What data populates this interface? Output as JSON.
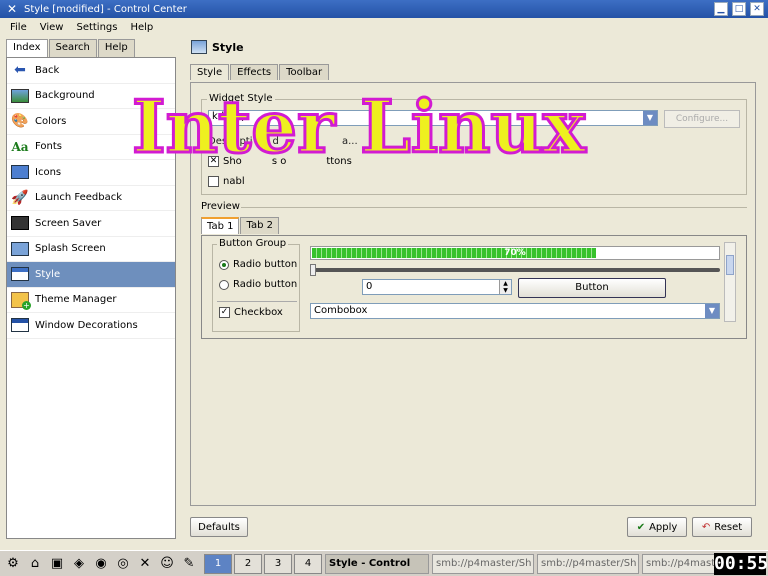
{
  "window": {
    "title": "Style [modified] - Control Center",
    "controls": {
      "minimize": "▁",
      "maximize": "□",
      "close": "✕"
    }
  },
  "menu": [
    "File",
    "View",
    "Settings",
    "Help"
  ],
  "left_tabs": [
    "Index",
    "Search",
    "Help"
  ],
  "left_items": [
    {
      "label": "Back",
      "icon": "back-arrow-icon"
    },
    {
      "label": "Background",
      "icon": "background-icon"
    },
    {
      "label": "Colors",
      "icon": "colors-icon"
    },
    {
      "label": "Fonts",
      "icon": "fonts-icon"
    },
    {
      "label": "Icons",
      "icon": "icons-icon"
    },
    {
      "label": "Launch Feedback",
      "icon": "rocket-icon"
    },
    {
      "label": "Screen Saver",
      "icon": "screen-saver-icon"
    },
    {
      "label": "Splash Screen",
      "icon": "splash-screen-icon"
    },
    {
      "label": "Style",
      "icon": "style-icon"
    },
    {
      "label": "Theme Manager",
      "icon": "theme-manager-icon"
    },
    {
      "label": "Window Decorations",
      "icon": "window-decorations-icon"
    }
  ],
  "module_title": "Style",
  "right_tabs": [
    "Style",
    "Effects",
    "Toolbar"
  ],
  "widget_style": {
    "legend": "Widget Style",
    "selected": "kde_xp",
    "configure_label": "Configure...",
    "description_prefix": "Descripti",
    "description_mid": "No d",
    "description_suffix": "a...",
    "show_icons_label_a": "Sho",
    "show_icons_label_b": "s o",
    "show_icons_label_c": "ttons",
    "enable_tooltips_label": "nabl"
  },
  "preview": {
    "legend": "Preview",
    "tabs": [
      "Tab 1",
      "Tab 2"
    ],
    "button_group_legend": "Button Group",
    "radio1": "Radio button",
    "radio2": "Radio button",
    "checkbox": "Checkbox",
    "progress_text": "70%",
    "progress_value": 0.7,
    "spin_value": "0",
    "button_label": "Button",
    "combobox_value": "Combobox"
  },
  "bottom": {
    "defaults": "Defaults",
    "apply": "Apply",
    "reset": "Reset"
  },
  "overlay_text": "Inter Linux",
  "taskbar": {
    "desktops": [
      "1",
      "2",
      "3",
      "4"
    ],
    "tasks": [
      "Style - Control",
      "smb://p4master/Sh",
      "smb://p4master/Sh",
      "smb://p4master/Sh"
    ],
    "clock": "00:55"
  }
}
